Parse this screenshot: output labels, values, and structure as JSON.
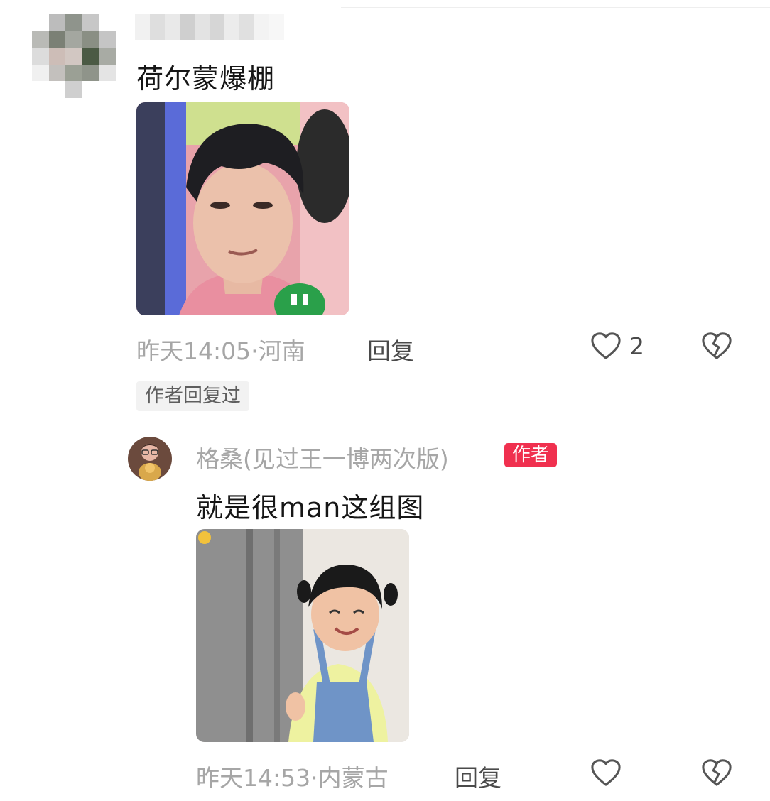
{
  "comment": {
    "text": "荷尔蒙爆棚",
    "time_location": "昨天14:05·河南",
    "reply_label": "回复",
    "like_count": "2",
    "author_replied_badge": "作者回复过",
    "avatar_colors": [
      "#ffffff",
      "#bcbcbc",
      "#8f948c",
      "#c7c7c7",
      "#ffffff",
      "#b9bab6",
      "#7b8075",
      "#a4a7a0",
      "#8a8f84",
      "#c5c5c5",
      "#dcdcdc",
      "#cdbdb7",
      "#d2c7c2",
      "#4b5a44",
      "#a8aba4",
      "#f0f0f0",
      "#c3c0bd",
      "#9ba095",
      "#8f948a",
      "#e4e4e4",
      "#ffffff",
      "#ffffff",
      "#cfcfcf",
      "#ffffff",
      "#ffffff"
    ],
    "name_blur_colors": [
      "#f1f1f1",
      "#dedede",
      "#e9e9e9",
      "#cfcfcf",
      "#e3e3e3",
      "#d6d6d6",
      "#ececec",
      "#e0e0e0",
      "#f3f3f3",
      "#f7f7f7"
    ]
  },
  "reply": {
    "author_name": "格桑(见过王一博两次版)",
    "author_tag": "作者",
    "text": "就是很man这组图",
    "time_location": "昨天14:53·内蒙古",
    "reply_label": "回复"
  },
  "colors": {
    "author_tag_bg": "#f0304f",
    "meta_text": "#a6a6a6",
    "icon_stroke": "#555555"
  }
}
